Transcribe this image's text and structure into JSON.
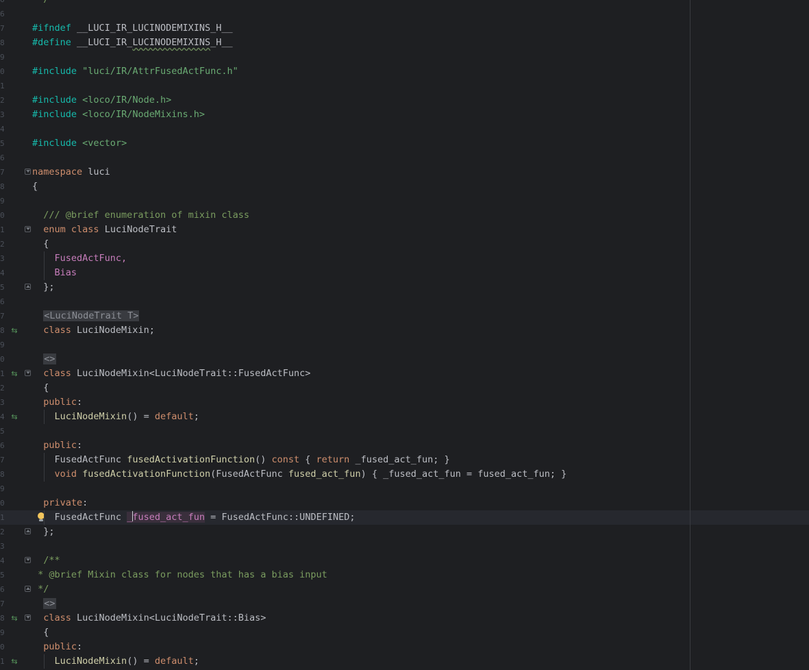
{
  "editor": {
    "line_numbers_visible": [
      "6",
      "6",
      "7",
      "8",
      "9",
      "0",
      "1",
      "2",
      "3",
      "4",
      "5",
      "6",
      "7",
      "8",
      "9",
      "0",
      "1",
      "2",
      "3",
      "4",
      "5",
      "6",
      "7",
      "8",
      "9",
      "0",
      "1",
      "2",
      "3",
      "4",
      "5",
      "6",
      "7",
      "8",
      "9",
      "0",
      "1",
      "2",
      "3",
      "4",
      "5",
      "6",
      "7",
      "8",
      "9",
      "0",
      "1"
    ],
    "lines": [
      {
        "tokens": [
          {
            "t": " */",
            "c": "cm"
          }
        ],
        "indent": 0
      },
      {
        "tokens": [],
        "indent": 0
      },
      {
        "tokens": [
          {
            "t": "#ifndef",
            "c": "pp"
          },
          {
            "t": " __LUCI_IR_LUCINODEMIXINS_H__",
            "c": "id"
          }
        ],
        "indent": 0
      },
      {
        "tokens": [
          {
            "t": "#define",
            "c": "pp"
          },
          {
            "t": " __LUCI_IR_",
            "c": "id"
          },
          {
            "t": "LUCINODEMIXINS",
            "c": "id sq"
          },
          {
            "t": "_H__",
            "c": "id"
          }
        ],
        "indent": 0
      },
      {
        "tokens": [],
        "indent": 0
      },
      {
        "tokens": [
          {
            "t": "#include",
            "c": "pp"
          },
          {
            "t": " ",
            "c": "id"
          },
          {
            "t": "\"luci/IR/AttrFusedActFunc.h\"",
            "c": "str"
          }
        ],
        "indent": 0
      },
      {
        "tokens": [],
        "indent": 0
      },
      {
        "tokens": [
          {
            "t": "#include",
            "c": "pp"
          },
          {
            "t": " ",
            "c": "id"
          },
          {
            "t": "<loco/IR/Node.h>",
            "c": "str"
          }
        ],
        "indent": 0
      },
      {
        "tokens": [
          {
            "t": "#include",
            "c": "pp"
          },
          {
            "t": " ",
            "c": "id"
          },
          {
            "t": "<loco/IR/NodeMixins.h>",
            "c": "str"
          }
        ],
        "indent": 0
      },
      {
        "tokens": [],
        "indent": 0
      },
      {
        "tokens": [
          {
            "t": "#include",
            "c": "pp"
          },
          {
            "t": " ",
            "c": "id"
          },
          {
            "t": "<vector>",
            "c": "str"
          }
        ],
        "indent": 0
      },
      {
        "tokens": [],
        "indent": 0
      },
      {
        "tokens": [
          {
            "t": "namespace",
            "c": "kw"
          },
          {
            "t": " luci",
            "c": "id"
          }
        ],
        "indent": 0,
        "fold": "start"
      },
      {
        "tokens": [
          {
            "t": "{",
            "c": "id"
          }
        ],
        "indent": 0
      },
      {
        "tokens": [],
        "indent": 0
      },
      {
        "tokens": [
          {
            "t": "/// @brief enumeration of mixin class",
            "c": "cm"
          }
        ],
        "indent": 2
      },
      {
        "tokens": [
          {
            "t": "enum",
            "c": "kw"
          },
          {
            "t": " ",
            "c": "id"
          },
          {
            "t": "class",
            "c": "kw"
          },
          {
            "t": " LuciNodeTrait",
            "c": "id"
          }
        ],
        "indent": 2,
        "fold": "start"
      },
      {
        "tokens": [
          {
            "t": "{",
            "c": "id"
          }
        ],
        "indent": 2
      },
      {
        "tokens": [
          {
            "t": "FusedActFunc,",
            "c": "mbr"
          }
        ],
        "indent": 4,
        "guide": true
      },
      {
        "tokens": [
          {
            "t": "Bias",
            "c": "mbr"
          }
        ],
        "indent": 4,
        "guide": true
      },
      {
        "tokens": [
          {
            "t": "};",
            "c": "id"
          }
        ],
        "indent": 2,
        "fold": "end"
      },
      {
        "tokens": [],
        "indent": 0
      },
      {
        "tokens": [
          {
            "t": "<LuciNodeTrait T>",
            "c": "tpl"
          }
        ],
        "indent": 2
      },
      {
        "tokens": [
          {
            "t": "class",
            "c": "kw"
          },
          {
            "t": " LuciNodeMixin;",
            "c": "id"
          }
        ],
        "indent": 2,
        "icon": "override-icon"
      },
      {
        "tokens": [],
        "indent": 0
      },
      {
        "tokens": [
          {
            "t": "<>",
            "c": "tpl"
          }
        ],
        "indent": 2
      },
      {
        "tokens": [
          {
            "t": "class",
            "c": "kw"
          },
          {
            "t": " LuciNodeMixin<LuciNodeTrait::FusedActFunc>",
            "c": "id"
          }
        ],
        "indent": 2,
        "fold": "start",
        "icon": "override-icon"
      },
      {
        "tokens": [
          {
            "t": "{",
            "c": "id"
          }
        ],
        "indent": 2
      },
      {
        "tokens": [
          {
            "t": "public",
            "c": "kw"
          },
          {
            "t": ":",
            "c": "id"
          }
        ],
        "indent": 2
      },
      {
        "tokens": [
          {
            "t": "LuciNodeMixin",
            "c": "hx"
          },
          {
            "t": "() = ",
            "c": "id"
          },
          {
            "t": "default",
            "c": "kw"
          },
          {
            "t": ";",
            "c": "id"
          }
        ],
        "indent": 4,
        "guide": true,
        "icon": "override-icon"
      },
      {
        "tokens": [],
        "indent": 0
      },
      {
        "tokens": [
          {
            "t": "public",
            "c": "kw"
          },
          {
            "t": ":",
            "c": "id"
          }
        ],
        "indent": 2
      },
      {
        "tokens": [
          {
            "t": "FusedActFunc ",
            "c": "id"
          },
          {
            "t": "fusedActivationFunction",
            "c": "hx"
          },
          {
            "t": "() ",
            "c": "id"
          },
          {
            "t": "const",
            "c": "kw"
          },
          {
            "t": " { ",
            "c": "id"
          },
          {
            "t": "return",
            "c": "kw"
          },
          {
            "t": " _fused_act_fun; }",
            "c": "id"
          }
        ],
        "indent": 4,
        "guide": true
      },
      {
        "tokens": [
          {
            "t": "void",
            "c": "kw"
          },
          {
            "t": " ",
            "c": "id"
          },
          {
            "t": "fusedActivationFunction",
            "c": "hx"
          },
          {
            "t": "(FusedActFunc ",
            "c": "id"
          },
          {
            "t": "fused_act_fun",
            "c": "hx"
          },
          {
            "t": ") { _fused_act_fun = fused_act_fun; }",
            "c": "id"
          }
        ],
        "indent": 4,
        "guide": true
      },
      {
        "tokens": [],
        "indent": 0
      },
      {
        "tokens": [
          {
            "t": "private",
            "c": "kw"
          },
          {
            "t": ":",
            "c": "id"
          }
        ],
        "indent": 2
      },
      {
        "tokens": [
          {
            "t": "FusedActFunc ",
            "c": "id"
          },
          {
            "t": "_f",
            "c": "fld sel",
            "caret": true
          },
          {
            "t": "used_act_fun",
            "c": "fld sel"
          },
          {
            "t": " = FusedActFunc::UNDEFINED;",
            "c": "id"
          }
        ],
        "indent": 4,
        "guide": true,
        "current": true,
        "bulb": true
      },
      {
        "tokens": [
          {
            "t": "};",
            "c": "id"
          }
        ],
        "indent": 2,
        "fold": "end"
      },
      {
        "tokens": [],
        "indent": 0
      },
      {
        "tokens": [
          {
            "t": "/**",
            "c": "cm"
          }
        ],
        "indent": 2,
        "fold": "start"
      },
      {
        "tokens": [
          {
            "t": " * @brief Mixin class for nodes that has a bias input",
            "c": "cm"
          }
        ],
        "indent": 0
      },
      {
        "tokens": [
          {
            "t": " */",
            "c": "cm"
          }
        ],
        "indent": 0,
        "fold": "end"
      },
      {
        "tokens": [
          {
            "t": "<>",
            "c": "tpl"
          }
        ],
        "indent": 2
      },
      {
        "tokens": [
          {
            "t": "class",
            "c": "kw"
          },
          {
            "t": " LuciNodeMixin<LuciNodeTrait::Bias>",
            "c": "id"
          }
        ],
        "indent": 2,
        "fold": "start",
        "icon": "override-icon"
      },
      {
        "tokens": [
          {
            "t": "{",
            "c": "id"
          }
        ],
        "indent": 2
      },
      {
        "tokens": [
          {
            "t": "public",
            "c": "kw"
          },
          {
            "t": ":",
            "c": "id"
          }
        ],
        "indent": 2
      },
      {
        "tokens": [
          {
            "t": "LuciNodeMixin",
            "c": "hx"
          },
          {
            "t": "() = ",
            "c": "id"
          },
          {
            "t": "default",
            "c": "kw"
          },
          {
            "t": ";",
            "c": "id"
          }
        ],
        "indent": 4,
        "guide": true,
        "icon": "override-icon"
      }
    ]
  },
  "icons": {
    "override": "⇆",
    "lightbulb": "intention-bulb-icon",
    "fold": "fold-marker-icon"
  },
  "colors": {
    "background": "#1e1f22",
    "keyword": "#cf8e6d",
    "preprocessor": "#16baac",
    "string": "#6aab73",
    "comment": "#7a9c5f",
    "function": "#cfcfa9",
    "field": "#c77dbb"
  }
}
